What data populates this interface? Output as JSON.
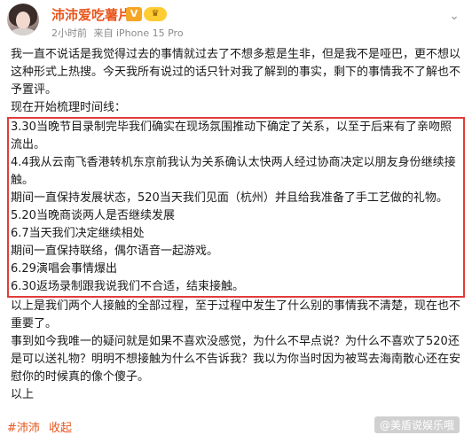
{
  "header": {
    "username": "沛沛爱吃薯片",
    "vip_badge": "V",
    "level_badge": "♛",
    "time": "2小时前",
    "source": "来自 iPhone 15 Pro"
  },
  "post": {
    "intro": [
      "我一直不说话是我觉得过去的事情就过去了不想多惹是生非，但是我不是哑巴，更不想以这种形式上热搜。今天我所有说过的话只针对我了解到的事实，剩下的事情我不了解也不予置评。",
      "现在开始梳理时间线："
    ],
    "timeline": [
      "3.30当晚节目录制完毕我们确实在现场氛围推动下确定了关系，以至于后来有了亲吻照流出。",
      "4.4我从云南飞香港转机东京前我认为关系确认太快两人经过协商决定以朋友身份继续接触。",
      "期间一直保持发展状态，520当天我们见面（杭州）并且给我准备了手工艺做的礼物。",
      "5.20当晚商谈两人是否继续发展",
      "6.7当天我们决定继续相处",
      "期间一直保持联络，偶尔语音一起游戏。",
      "6.29演唱会事情爆出",
      "6.30返场录制跟我说我们不合适，结束接触。"
    ],
    "outro": [
      "以上是我们两个人接触的全部过程，至于过程中发生了什么别的事情我不清楚，现在也不重要了。",
      "事到如今我唯一的疑问就是如果不喜欢没感觉，为什么不早点说？为什么不喜欢了520还是可以送礼物？明明不想接触为什么不告诉我？我以为你当时因为被骂去海南散心还在安慰你的时候真的像个傻子。",
      "以上"
    ]
  },
  "footer": {
    "tag": "#沛沛",
    "collapse": "收起"
  },
  "watermark": "@美盾说娱乐哦"
}
